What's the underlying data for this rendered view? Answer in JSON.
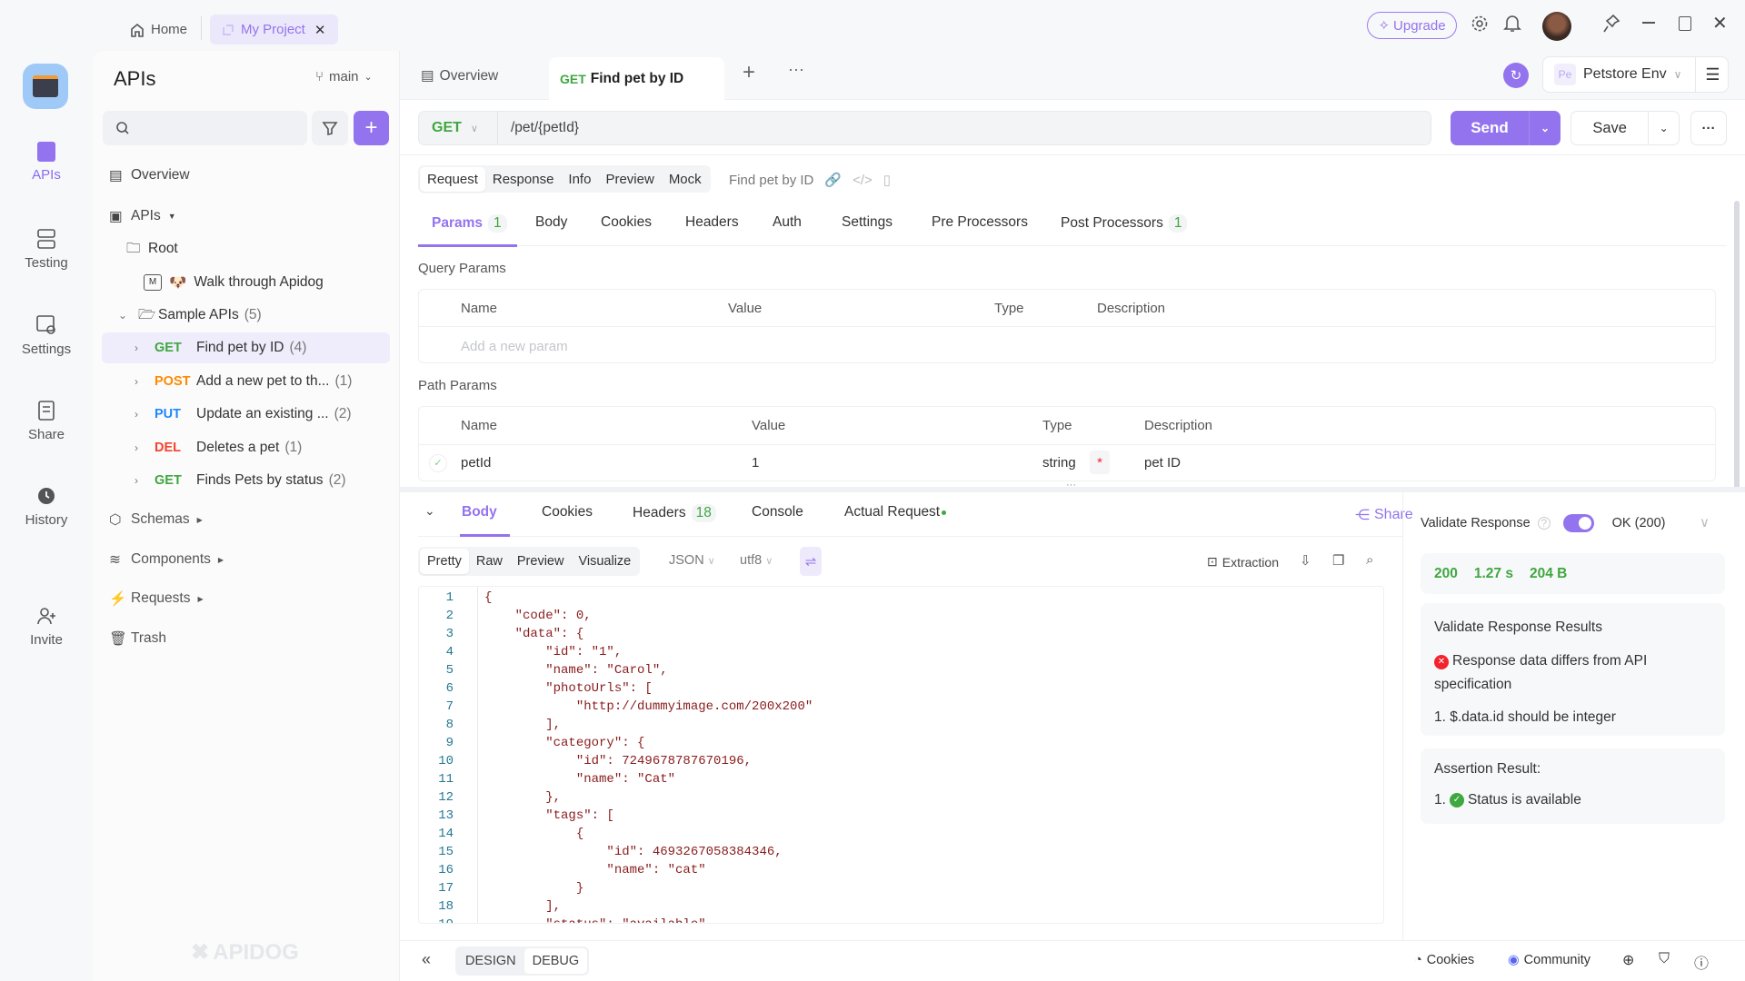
{
  "topbar": {
    "home": "Home",
    "project_tab": "My Project",
    "upgrade": "Upgrade"
  },
  "rail": {
    "items": [
      {
        "label": "APIs"
      },
      {
        "label": "Testing"
      },
      {
        "label": "Settings"
      },
      {
        "label": "Share"
      },
      {
        "label": "History"
      },
      {
        "label": "Invite"
      }
    ]
  },
  "sidebar": {
    "title": "APIs",
    "branch": "main",
    "search_placeholder": "",
    "overview": "Overview",
    "apis": "APIs",
    "root": "Root",
    "walkthrough": "Walk through Apidog",
    "walkthrough_emoji": "🐶",
    "folder": {
      "label": "Sample APIs",
      "count": "(5)"
    },
    "endpoints": [
      {
        "method": "GET",
        "name": "Find pet by ID",
        "count": "(4)",
        "color": "#3fa73f"
      },
      {
        "method": "POST",
        "name": "Add a new pet to th...",
        "count": "(1)",
        "color": "#ff8a00"
      },
      {
        "method": "PUT",
        "name": "Update an existing ...",
        "count": "(2)",
        "color": "#1e88ff"
      },
      {
        "method": "DEL",
        "name": "Deletes a pet",
        "count": "(1)",
        "color": "#f5412e"
      },
      {
        "method": "GET",
        "name": "Finds Pets by status",
        "count": "(2)",
        "color": "#3fa73f"
      }
    ],
    "schemas": "Schemas",
    "components": "Components",
    "requests": "Requests",
    "trash": "Trash",
    "watermark": "APIDOG"
  },
  "tabs": {
    "overview": "Overview",
    "active_method": "GET",
    "active_name": "Find pet by ID",
    "env_badge": "Pe",
    "env": "Petstore Env"
  },
  "request": {
    "method": "GET",
    "url": "/pet/{petId}",
    "send": "Send",
    "save": "Save"
  },
  "mode_tabs": [
    "Request",
    "Response",
    "Info",
    "Preview",
    "Mock"
  ],
  "endpoint_name": "Find pet by ID",
  "param_tabs": [
    {
      "label": "Params",
      "badge": "1"
    },
    {
      "label": "Body"
    },
    {
      "label": "Cookies"
    },
    {
      "label": "Headers"
    },
    {
      "label": "Auth"
    },
    {
      "label": "Settings"
    },
    {
      "label": "Pre Processors"
    },
    {
      "label": "Post Processors",
      "badge": "1"
    }
  ],
  "query": {
    "title": "Query Params",
    "headers": [
      "Name",
      "Value",
      "Type",
      "Description"
    ],
    "placeholder": "Add a new param"
  },
  "path": {
    "title": "Path Params",
    "headers": [
      "Name",
      "Value",
      "Type",
      "Description"
    ],
    "rows": [
      {
        "name": "petId",
        "value": "1",
        "type": "string",
        "required": "*",
        "description": "pet ID"
      }
    ]
  },
  "response": {
    "tabs": [
      {
        "label": "Body"
      },
      {
        "label": "Cookies"
      },
      {
        "label": "Headers",
        "badge": "18"
      },
      {
        "label": "Console"
      },
      {
        "label": "Actual Request"
      }
    ],
    "share": "Share",
    "views": [
      "Pretty",
      "Raw",
      "Preview",
      "Visualize"
    ],
    "format": "JSON",
    "encoding": "utf8",
    "extraction": "Extraction",
    "code": [
      "{",
      "    \"code\": 0,",
      "    \"data\": {",
      "        \"id\": \"1\",",
      "        \"name\": \"Carol\",",
      "        \"photoUrls\": [",
      "            \"http://dummyimage.com/200x200\"",
      "        ],",
      "        \"category\": {",
      "            \"id\": 7249678787670196,",
      "            \"name\": \"Cat\"",
      "        },",
      "        \"tags\": [",
      "            {",
      "                \"id\": 4693267058384346,",
      "                \"name\": \"cat\"",
      "            }",
      "        ],",
      "        \"status\": \"available\""
    ]
  },
  "validation": {
    "label": "Validate Response",
    "enabled": true,
    "status_option": "OK (200)",
    "status": "200",
    "time": "1.27 s",
    "size": "204 B",
    "results_title": "Validate Response Results",
    "error": "Response data differs from API specification",
    "error_item": "1. $.data.id should be integer",
    "assertion_title": "Assertion Result:",
    "assertion_num": "1.",
    "assertion_item": "Status is available"
  },
  "bottombar": {
    "design": "DESIGN",
    "debug": "DEBUG",
    "cookies": "Cookies",
    "community": "Community"
  },
  "colors": {
    "accent": "#9373ee",
    "success": "#3fa73f",
    "error": "#f5222d"
  }
}
